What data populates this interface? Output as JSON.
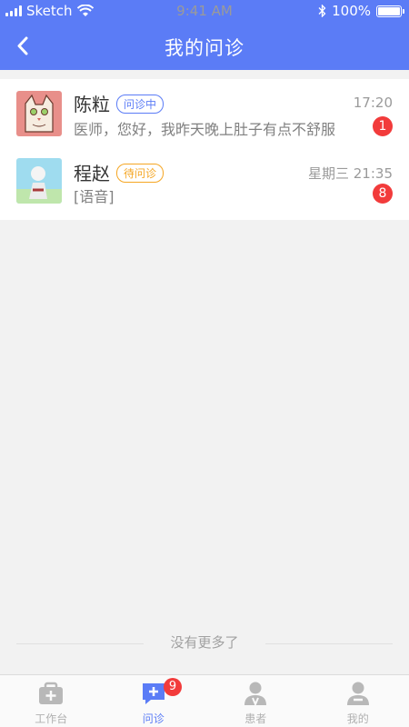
{
  "status_bar": {
    "carrier": "Sketch",
    "time": "9:41 AM",
    "battery": "100%"
  },
  "nav": {
    "title": "我的问诊",
    "back_icon": "chevron-left-icon"
  },
  "conversations": [
    {
      "name": "陈粒",
      "status": "问诊中",
      "time": "17:20",
      "preview": "医师，您好，我昨天晚上肚子有点不舒服",
      "unread": "1"
    },
    {
      "name": "程赵",
      "status": "待问诊",
      "time": "星期三 21:35",
      "preview": "[语音]",
      "unread": "8"
    }
  ],
  "footer_note": "没有更多了",
  "tabs": [
    {
      "label": "工作台",
      "icon": "medical-kit-icon",
      "active": false
    },
    {
      "label": "问诊",
      "icon": "chat-plus-icon",
      "active": true,
      "badge": "9"
    },
    {
      "label": "患者",
      "icon": "patient-icon",
      "active": false
    },
    {
      "label": "我的",
      "icon": "profile-icon",
      "active": false
    }
  ],
  "colors": {
    "primary": "#5b7cf6",
    "badge": "#f23b3b",
    "pending": "#f5a623"
  }
}
